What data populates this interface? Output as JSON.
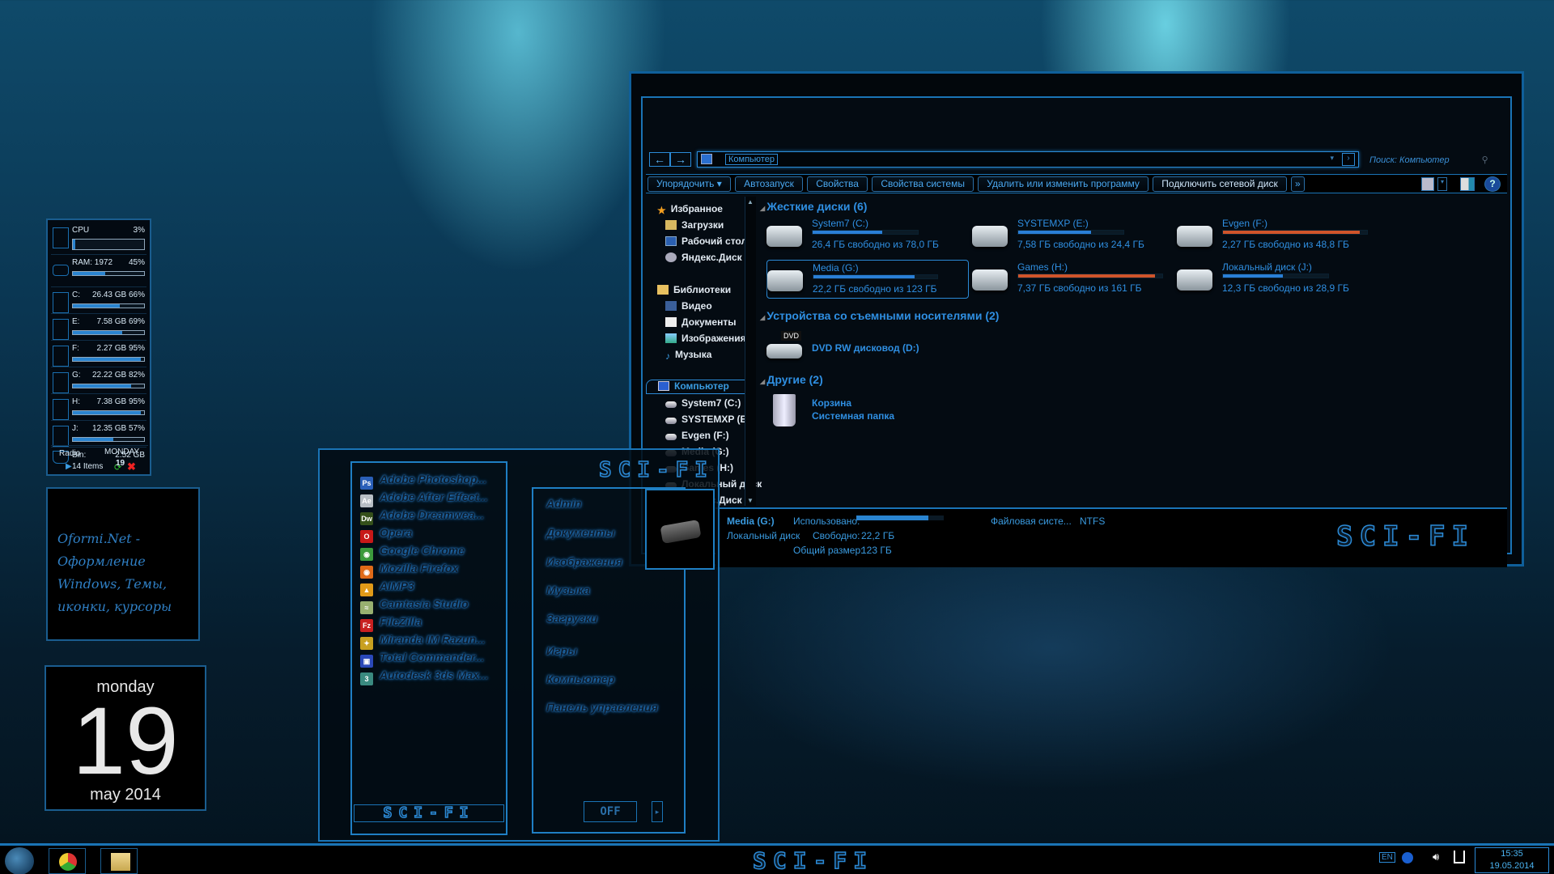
{
  "system_gadget": {
    "cpu": {
      "label": "CPU",
      "value": "3%",
      "percent": 3
    },
    "ram": {
      "label": "RAM: 1972",
      "value": "45%",
      "percent": 45
    },
    "drives": [
      {
        "label": "C:",
        "value": "26.43 GB 66%",
        "percent": 66
      },
      {
        "label": "E:",
        "value": "7.58 GB 69%",
        "percent": 69
      },
      {
        "label": "F:",
        "value": "2.27 GB 95%",
        "percent": 95
      },
      {
        "label": "G:",
        "value": "22.22 GB 82%",
        "percent": 82
      },
      {
        "label": "H:",
        "value": "7.38 GB 95%",
        "percent": 95
      },
      {
        "label": "J:",
        "value": "12.35 GB 57%",
        "percent": 57
      }
    ],
    "bin": {
      "label": "Bin:",
      "size": "2.52 GB",
      "items": "14 Items"
    },
    "radio_label": "Radio",
    "day": "MONDAY",
    "date": "19"
  },
  "note_gadget": {
    "text_lines": [
      "Oformi.Net -",
      "Оформление",
      "Windows, Темы,",
      "иконки, курсоры"
    ]
  },
  "calendar_gadget": {
    "weekday": "monday",
    "day": "19",
    "month_year": "may 2014"
  },
  "explorer": {
    "address_crumb": "Компьютер",
    "search_placeholder": "Поиск: Компьютер",
    "toolbar": [
      "Упорядочить ▾",
      "Автозапуск",
      "Свойства",
      "Свойства системы",
      "Удалить или изменить программу",
      "Подключить сетевой диск",
      "»"
    ],
    "nav": {
      "favorites": "Избранное",
      "favorites_items": [
        "Загрузки",
        "Рабочий стол",
        "Яндекс.Диск"
      ],
      "libraries": "Библиотеки",
      "libraries_items": [
        "Видео",
        "Документы",
        "Изображения",
        "Музыка"
      ],
      "computer": "Компьютер",
      "computer_items": [
        "System7 (C:)",
        "SYSTEMXP (E:)",
        "Evgen (F:)",
        "Media (G:)",
        "Games (H:)",
        "Локальный диск",
        "Яндекс.Диск"
      ]
    },
    "groups": {
      "hard_disks": "Жесткие диски (6)",
      "removable": "Устройства со съемными носителями (2)",
      "other": "Другие (2)"
    },
    "drives": [
      {
        "name": "System7 (C:)",
        "free": "26,4 ГБ свободно из 78,0 ГБ",
        "used_fraction": 0.66,
        "color": "#2a7fd6"
      },
      {
        "name": "SYSTEMXP (E:)",
        "free": "7,58 ГБ свободно из 24,4 ГБ",
        "used_fraction": 0.69,
        "color": "#2a7fd6"
      },
      {
        "name": "Evgen (F:)",
        "free": "2,27 ГБ свободно из 48,8 ГБ",
        "used_fraction": 0.95,
        "color": "#d0542a"
      },
      {
        "name": "Media (G:)",
        "free": "22,2 ГБ свободно из 123 ГБ",
        "used_fraction": 0.82,
        "color": "#2a7fd6"
      },
      {
        "name": "Games (H:)",
        "free": "7,37 ГБ свободно из 161 ГБ",
        "used_fraction": 0.95,
        "color": "#d0542a"
      },
      {
        "name": "Локальный диск (J:)",
        "free": "12,3 ГБ свободно из 28,9 ГБ",
        "used_fraction": 0.57,
        "color": "#2a7fd6"
      }
    ],
    "dvd": {
      "name": "DVD RW дисковод (D:)",
      "badge": "DVD"
    },
    "recycle": {
      "name": "Корзина",
      "sub": "Системная папка"
    },
    "details": {
      "name": "Media (G:)",
      "type": "Локальный диск",
      "used_label": "Использовано:",
      "used_fraction": 0.82,
      "free_label": "Свободно:",
      "free_value": "22,2 ГБ",
      "total_label": "Общий размер:",
      "total_value": "123 ГБ",
      "fs_label": "Файловая систе...",
      "fs_value": "NTFS"
    },
    "brand": "SCI-FI"
  },
  "start_menu": {
    "brand": "SCI-FI",
    "apps": [
      {
        "label": "Adobe Photoshop...",
        "icon": "Ps",
        "color": "#2a5fb8"
      },
      {
        "label": "Adobe After Effect...",
        "icon": "Ae",
        "color": "#b8bec4"
      },
      {
        "label": "Adobe Dreamwea...",
        "icon": "Dw",
        "color": "#35501a"
      },
      {
        "label": "Opera",
        "icon": "O",
        "color": "#c81818"
      },
      {
        "label": "Google Chrome",
        "icon": "◉",
        "color": "#3c9a3c"
      },
      {
        "label": "Mozilla Firefox",
        "icon": "◉",
        "color": "#e06a18"
      },
      {
        "label": "AIMP3",
        "icon": "▲",
        "color": "#e09a18"
      },
      {
        "label": "Camtasia Studio",
        "icon": "≈",
        "color": "#98b070"
      },
      {
        "label": "FileZilla",
        "icon": "Fz",
        "color": "#c82020"
      },
      {
        "label": "Miranda IM Razun...",
        "icon": "✦",
        "color": "#c8a020"
      },
      {
        "label": "Total Commander...",
        "icon": "▣",
        "color": "#2a48b8"
      },
      {
        "label": "Autodesk 3ds Max...",
        "icon": "3",
        "color": "#3a8a80"
      }
    ],
    "places": [
      "Admin",
      "Документы",
      "Изображения",
      "Музыка",
      "Загрузки",
      "Игры",
      "Компьютер",
      "Панель управления"
    ],
    "power_label": "OFF"
  },
  "taskbar": {
    "brand": "SCI-FI",
    "lang": "EN",
    "time": "15:35",
    "date": "19.05.2014"
  }
}
